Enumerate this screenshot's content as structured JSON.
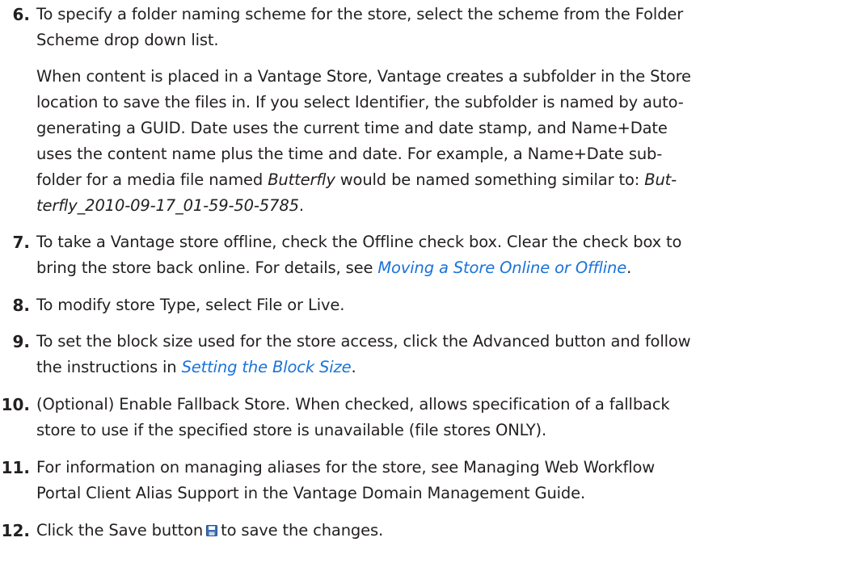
{
  "steps": {
    "s6": {
      "num": "6.",
      "lines": [
        "To specify a folder naming scheme for the store, select the scheme from the Folder",
        "Scheme drop down list."
      ],
      "para": [
        "When content is placed in a Vantage Store, Vantage creates a subfolder in the Store",
        "location to save the files in. If you select Identifier, the subfolder is named by auto-",
        "generating a GUID. Date uses the current time and date stamp, and Name+Date",
        "uses the content name plus the time and date. For example, a Name+Date sub-"
      ],
      "para_l5_a": "folder for a media file named ",
      "para_l5_italic": "Butterfly",
      "para_l5_b": " would be named something similar to: ",
      "para_l5_italic2": "But-",
      "para_l6_italic": "terfly_2010-09-17_01-59-50-5785",
      "para_l6_end": "."
    },
    "s7": {
      "num": "7.",
      "line1": "To take a Vantage store offline, check the Offline check box. Clear the check box to",
      "line2_a": "bring the store back online. For details, see ",
      "line2_link": "Moving a Store Online or Offline",
      "line2_end": "."
    },
    "s8": {
      "num": "8.",
      "line1": " To modify store Type, select File or Live."
    },
    "s9": {
      "num": "9.",
      "line1": "To set the block size used for the store access, click the Advanced button and follow",
      "line2_a": "the instructions in ",
      "line2_link": "Setting the Block Size",
      "line2_end": "."
    },
    "s10": {
      "num": "10.",
      "line1": " (Optional) Enable Fallback Store. When checked, allows specification of a fallback",
      "line2": "store to use if the specified store is unavailable (file stores ONLY)."
    },
    "s11": {
      "num": "11.",
      "line1": "For information on managing aliases for the store, see Managing Web Workflow",
      "line2": "Portal Client Alias Support in the Vantage Domain Management Guide."
    },
    "s12": {
      "num": "12.",
      "line1_a": "Click the Save button",
      "save_icon": "save-icon",
      "line1_b": "to save the changes."
    }
  },
  "colors": {
    "text": "#231f20",
    "link": "#1a73d9",
    "save_icon_body": "#3b6fb6"
  }
}
